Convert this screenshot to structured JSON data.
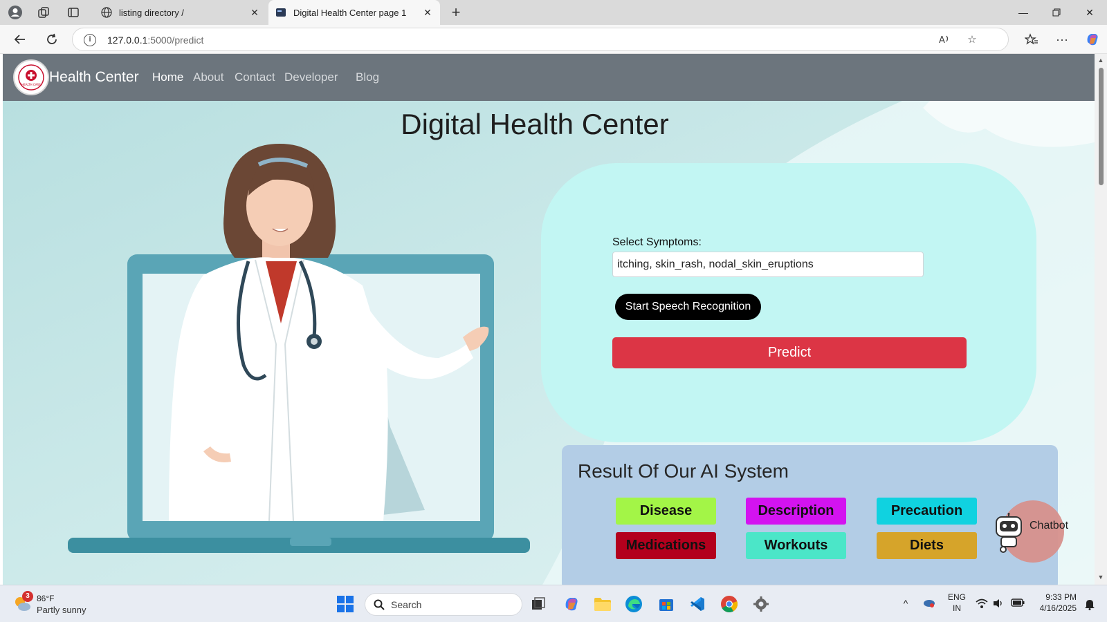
{
  "browser": {
    "tabs": [
      {
        "title": "listing directory /",
        "active": false
      },
      {
        "title": "Digital Health Center page 1",
        "active": true
      }
    ],
    "url_host": "127.0.0.1",
    "url_path": ":5000/predict"
  },
  "navbar": {
    "brand": "Health Center",
    "logo_text": "HEALTH CARE",
    "links": [
      "Home",
      "About",
      "Contact",
      "Developer",
      "Blog"
    ],
    "active_link": "Home"
  },
  "hero": {
    "title": "Digital Health Center"
  },
  "form": {
    "label": "Select Symptoms:",
    "symptoms_value": "itching, skin_rash, nodal_skin_eruptions",
    "speech_button": "Start Speech Recognition",
    "predict_button": "Predict"
  },
  "results": {
    "title": "Result Of Our AI System",
    "buttons": [
      {
        "label": "Disease",
        "color": "#a3f547"
      },
      {
        "label": "Description",
        "color": "#d313f0"
      },
      {
        "label": "Precaution",
        "color": "#10d2e0"
      },
      {
        "label": "Medications",
        "color": "#b3001d"
      },
      {
        "label": "Workouts",
        "color": "#4be6c8"
      },
      {
        "label": "Diets",
        "color": "#d6a42a"
      }
    ]
  },
  "chatbot": {
    "label": "Chatbot"
  },
  "taskbar": {
    "weather_badge": "3",
    "temperature": "86°F",
    "weather_desc": "Partly sunny",
    "search_placeholder": "Search",
    "lang_top": "ENG",
    "lang_bottom": "IN",
    "time": "9:33 PM",
    "date": "4/16/2025"
  },
  "colors": {
    "navbar": "#6c757d",
    "predict": "#dc3545",
    "form_panel": "#c2f6f3",
    "result_panel": "#b3cde6"
  }
}
